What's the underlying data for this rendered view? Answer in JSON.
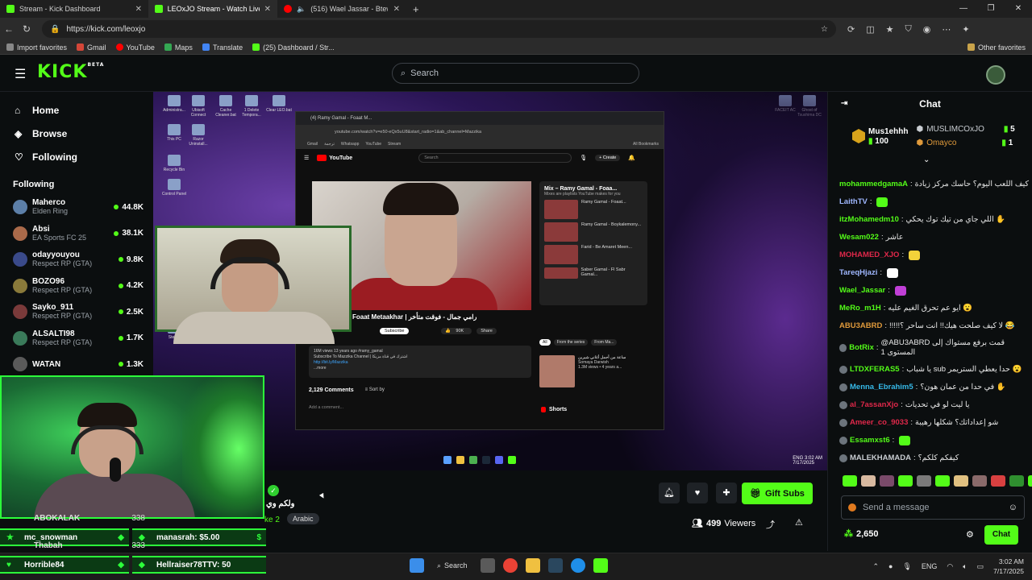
{
  "browser": {
    "tabs": [
      {
        "title": "Stream - Kick Dashboard",
        "active": false
      },
      {
        "title": "LEOxJO Stream - Watch Live on Kick",
        "active": true
      },
      {
        "title": "(516) Wael Jassar - Btew7ashni",
        "active": false
      }
    ],
    "url": "https://kick.com/leoxjo",
    "bookmarks": [
      "Import favorites",
      "Gmail",
      "YouTube",
      "Maps",
      "Translate",
      "(25) Dashboard / Str..."
    ],
    "other_favorites": "Other favorites"
  },
  "kick": {
    "logo": "KICK",
    "logo_beta": "BETA",
    "search_placeholder": "Search",
    "nav": [
      {
        "label": "Home",
        "icon": "home-icon"
      },
      {
        "label": "Browse",
        "icon": "compass-icon"
      },
      {
        "label": "Following",
        "icon": "heart-icon"
      }
    ],
    "following_title": "Following",
    "following": [
      {
        "name": "Maherco",
        "game": "Elden Ring",
        "viewers": "44.8K"
      },
      {
        "name": "Absi",
        "game": "EA Sports FC 25",
        "viewers": "38.1K"
      },
      {
        "name": "odayyouyou",
        "game": "Respect RP (GTA)",
        "viewers": "9.8K"
      },
      {
        "name": "BOZO96",
        "game": "Respect RP (GTA)",
        "viewers": "4.2K"
      },
      {
        "name": "Sayko_911",
        "game": "Respect RP (GTA)",
        "viewers": "2.5K"
      },
      {
        "name": "ALSALTI98",
        "game": "Respect RP (GTA)",
        "viewers": "1.7K"
      },
      {
        "name": "WATAN",
        "game": "",
        "viewers": "1.3K"
      }
    ]
  },
  "stream_screen": {
    "desktop_icons": [
      "Administra...",
      "Ubisoft Connect",
      "Cache Cleaner.bat",
      "1 Delete Tempora...",
      "Clear LEO.bat",
      "This PC",
      "Razor Uninstall...",
      "Recycle Bin",
      "Control Panel",
      "Steam",
      "FACEIT AC",
      "Ghost of Tsushima DC"
    ],
    "yt": {
      "tab": "(4) Ramy Gamal - Foaat M...",
      "url": "youtube.com/watch?v=e50-eQx5uU8&start_radio=1&ab_channel=Mazzika",
      "bookmarks": [
        "Gmail",
        "ترجمة",
        "Whatsapp",
        "YouTube",
        "Stream"
      ],
      "all_bookmarks": "All Bookmarks",
      "logo": "YouTube",
      "search": "Search",
      "create": "Create",
      "video_title": "Foaat Metaakhar | رامي جمال - فوقت متأخر",
      "subscribe": "Subscribe",
      "likes": "90K",
      "share": "Share",
      "desc_line1": "16M views  13 years ago  #ramy_gamal",
      "desc_line2": "Subscribe To Mazzika Channel | اشترك في قناة مزيكا",
      "desc_line3": "http://bit.ly/Mazzika",
      "desc_more": "...more",
      "comments": "2,129 Comments",
      "sort": "Sort by",
      "add_comment": "Add a comment...",
      "mix_title": "Mix – Ramy Gamal - Foaa...",
      "mix_sub": "Mixes are playlists YouTube makes for you",
      "mix_items": [
        "Ramy Gamal - Foaat...",
        "Ramy Gamal - Boykalemony...",
        "Farid - Be Amaret Meen...",
        "Saber Gamal - Fl Sabr Gamal..."
      ],
      "chips": [
        "All",
        "From the series",
        "From Ma..."
      ],
      "rec_title": "ساعة من أجمل أغاني شيرين",
      "rec_channel": "Somaya Darwish",
      "rec_meta": "1.3M views • 4 years a...",
      "shorts": "Shorts"
    },
    "clock_time": "3:02 AM",
    "clock_date": "7/17/2025",
    "lang_tray": "ENG"
  },
  "overlay": {
    "rows": [
      {
        "left_name": "ABOKALAK",
        "left_val": "338",
        "right_name": "",
        "right_val": ""
      },
      {
        "left_name": "mc_snowman",
        "left_val": "",
        "right_name": "manasrah: $5.00",
        "right_val": "$"
      },
      {
        "left_name": "Thabah",
        "left_val": "333",
        "right_name": "",
        "right_val": ""
      },
      {
        "left_name": "Horrible84",
        "left_val": "",
        "right_name": "Hellraiser78TTV: 50",
        "right_val": ""
      }
    ]
  },
  "below": {
    "title_fragment": "ولكم وي",
    "category_fragment": "ke 2",
    "language": "Arabic",
    "gift_subs": "Gift Subs",
    "viewers_count": "499",
    "viewers_label": "Viewers"
  },
  "chat": {
    "title": "Chat",
    "top_gifter_name": "Mus1ehhh",
    "top_gifter_count": "100",
    "gifters": [
      {
        "name": "MUSLIMCOxJO",
        "count": "5",
        "color": "#c9cdd2"
      },
      {
        "name": "Omayco",
        "count": "1",
        "color": "#e09a3b"
      }
    ],
    "messages": [
      {
        "user": "mohammedgamaA",
        "color": "#53fc18",
        "text": "كيف اللعب اليوم؟ حاسك مركز زيادة",
        "emote": ""
      },
      {
        "user": "LaithTV",
        "color": "#9fb7ff",
        "text": "",
        "emote": "#53fc18"
      },
      {
        "user": "itzMohamedm10",
        "color": "#53fc18",
        "text": "اللي جاي من تيك توك يحكي ✋",
        "emote": ""
      },
      {
        "user": "Wesam022",
        "color": "#53fc18",
        "text": "عاشر",
        "emote": ""
      },
      {
        "user": "MOHAMED_XJO",
        "color": "#e0284a",
        "text": "",
        "emote": "#f3d23a"
      },
      {
        "user": "TareqHjazi",
        "color": "#9fb7ff",
        "text": "",
        "emote": "#ffffff"
      },
      {
        "user": "Wael_Jassar",
        "color": "#53fc18",
        "text": "",
        "emote": "#c03fd6"
      },
      {
        "user": "MeRo_m1H",
        "color": "#53fc18",
        "text": "ايو عم تحرق الغيم عليه 😮",
        "emote": ""
      },
      {
        "user": "ABU3ABRD",
        "color": "#e09a3b",
        "text": "!!!!!لا كيف صلحت هيك!! انت ساحر ؟ 😂",
        "emote": ""
      },
      {
        "user": "BotRix",
        "color": "#53fc18",
        "text": "@ABU3ABRD قمت برفع مستواك إلى المستوى 1",
        "emote": "",
        "two": true
      },
      {
        "user": "LTDXFERAS5",
        "color": "#53fc18",
        "text": "يا شباب sub حدا يعطي الستريمر 😮",
        "emote": ""
      },
      {
        "user": "Menna_Ebrahim5",
        "color": "#36b9e8",
        "text": "في حدا من عمان هون؟ ✋",
        "emote": ""
      },
      {
        "user": "al_7assanXjo",
        "color": "#e0284a",
        "text": "يا ليت لو في تحديات",
        "emote": ""
      },
      {
        "user": "Ameer_co_9033",
        "color": "#e0284a",
        "text": "شو إعداداتك؟ شكلها رهيبة",
        "emote": ""
      },
      {
        "user": "Essamxst6",
        "color": "#53fc18",
        "text": "",
        "emote": "#53fc18"
      },
      {
        "user": "MALEKHAMADA",
        "color": "#c9cdd2",
        "text": "كيفكم كلكم؟",
        "emote": ""
      }
    ],
    "input_placeholder": "Send a message",
    "points": "2,650",
    "send_label": "Chat",
    "emote_colors": [
      "#53fc18",
      "#d8b9a0",
      "#7a4a6a",
      "#53fc18",
      "#7a7a7a",
      "#53fc18",
      "#e0c080",
      "#8a6a6a",
      "#d84040",
      "#2f8f2f",
      "#53fc18"
    ]
  },
  "taskbar": {
    "search": "Search",
    "lang": "ENG",
    "time": "3:02 AM",
    "date": "7/17/2025"
  }
}
